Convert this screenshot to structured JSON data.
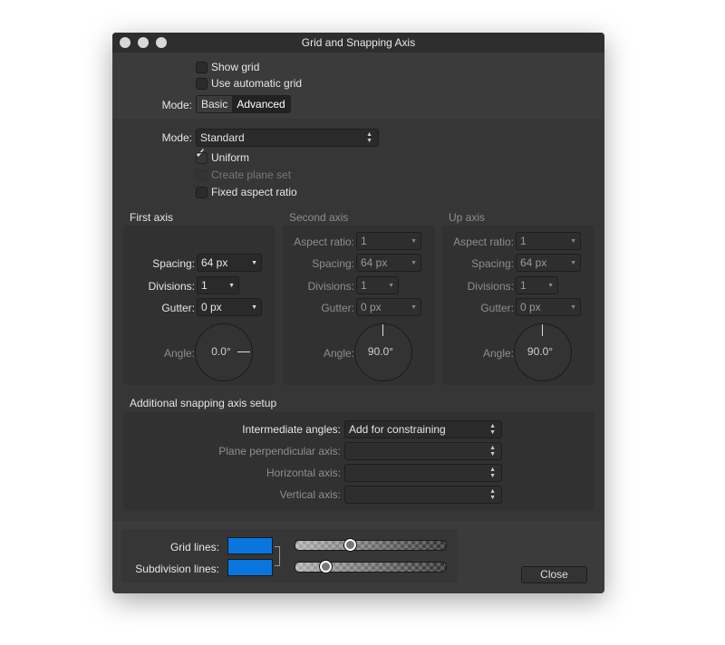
{
  "window": {
    "title": "Grid and Snapping Axis"
  },
  "top": {
    "show_grid": {
      "label": "Show grid",
      "checked": false
    },
    "automatic_grid": {
      "label": "Use automatic grid",
      "checked": false
    },
    "mode_label": "Mode:",
    "mode_options": [
      "Basic",
      "Advanced"
    ],
    "mode_selected": "Advanced"
  },
  "advanced": {
    "mode_label": "Mode:",
    "mode_value": "Standard",
    "uniform": {
      "label": "Uniform",
      "checked": true
    },
    "create_plane_set": {
      "label": "Create plane set",
      "checked": false,
      "disabled": true
    },
    "fixed_aspect": {
      "label": "Fixed aspect ratio",
      "checked": false
    }
  },
  "axes": {
    "first": {
      "title": "First axis",
      "spacing_label": "Spacing:",
      "spacing": "64 px",
      "divisions_label": "Divisions:",
      "divisions": "1",
      "gutter_label": "Gutter:",
      "gutter": "0 px",
      "angle_label": "Angle:",
      "angle": "0.0°"
    },
    "second": {
      "title": "Second axis",
      "aspect_label": "Aspect ratio:",
      "aspect": "1",
      "spacing_label": "Spacing:",
      "spacing": "64 px",
      "divisions_label": "Divisions:",
      "divisions": "1",
      "gutter_label": "Gutter:",
      "gutter": "0 px",
      "angle_label": "Angle:",
      "angle": "90.0°"
    },
    "up": {
      "title": "Up axis",
      "aspect_label": "Aspect ratio:",
      "aspect": "1",
      "spacing_label": "Spacing:",
      "spacing": "64 px",
      "divisions_label": "Divisions:",
      "divisions": "1",
      "gutter_label": "Gutter:",
      "gutter": "0 px",
      "angle_label": "Angle:",
      "angle": "90.0°"
    }
  },
  "additional": {
    "title": "Additional snapping axis setup",
    "intermediate_label": "Intermediate angles:",
    "intermediate_value": "Add for constraining",
    "plane_perp_label": "Plane perpendicular axis:",
    "plane_perp_value": "",
    "horizontal_label": "Horizontal axis:",
    "horizontal_value": "",
    "vertical_label": "Vertical axis:",
    "vertical_value": ""
  },
  "colors": {
    "grid_lines_label": "Grid lines:",
    "grid_lines_color": "#0a75de",
    "grid_lines_opacity": 0.36,
    "subdivision_label": "Subdivision lines:",
    "subdivision_color": "#0a75de",
    "subdivision_opacity": 0.2,
    "linked": true
  },
  "close_label": "Close"
}
